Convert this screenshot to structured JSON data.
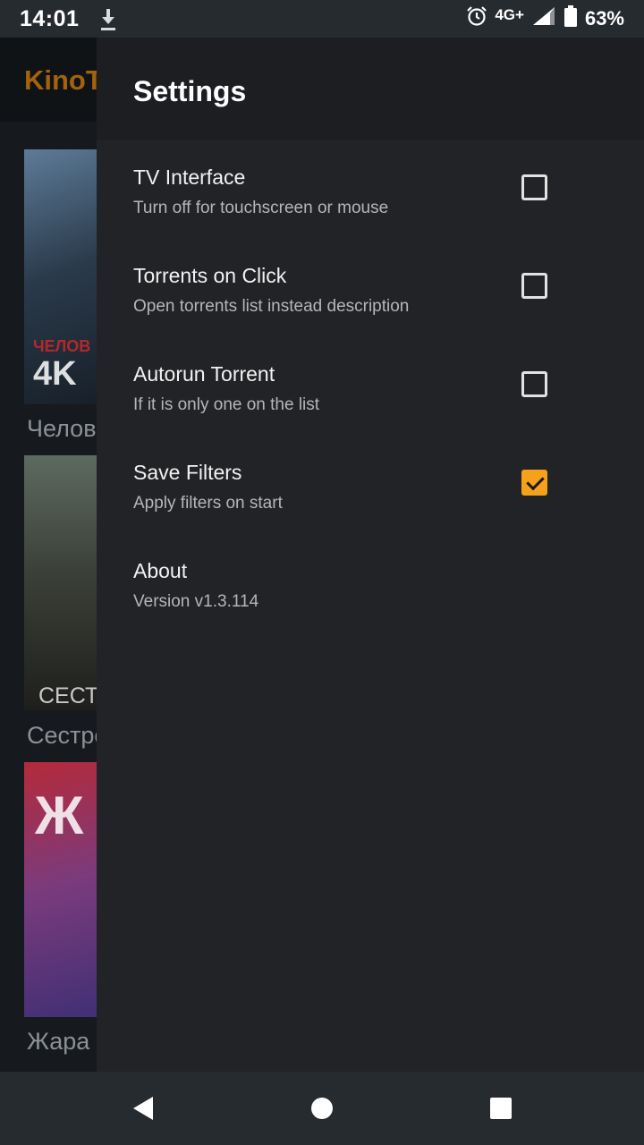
{
  "status_bar": {
    "time": "14:01",
    "network": "4G+",
    "battery": "63%",
    "icons": [
      "download-icon",
      "alarm-icon",
      "signal-icon",
      "battery-icon"
    ]
  },
  "background_app": {
    "title": "KinoT",
    "posters": [
      {
        "caption": "Челове",
        "badge": "4K",
        "text": "ЧЕЛОВ"
      },
      {
        "caption": "Сестре",
        "text": "СЕСТ"
      },
      {
        "caption": "Жара",
        "text": "Ж"
      }
    ]
  },
  "drawer": {
    "title": "Settings",
    "items": [
      {
        "label": "TV Interface",
        "sub": "Turn off for touchscreen or mouse",
        "checked": false
      },
      {
        "label": "Torrents on Click",
        "sub": "Open torrents list instead description",
        "checked": false
      },
      {
        "label": "Autorun Torrent",
        "sub": "If it is only one on the list",
        "checked": false
      },
      {
        "label": "Save Filters",
        "sub": "Apply filters on start",
        "checked": true
      },
      {
        "label": "About",
        "sub": "Version v1.3.114"
      }
    ]
  },
  "colors": {
    "accent": "#f5a11c",
    "app_title": "#a3620e",
    "drawer_bg": "#222326",
    "status_bar": "#262b30"
  },
  "nav_bar": {
    "icons": [
      "back-icon",
      "home-icon",
      "recents-icon"
    ]
  }
}
